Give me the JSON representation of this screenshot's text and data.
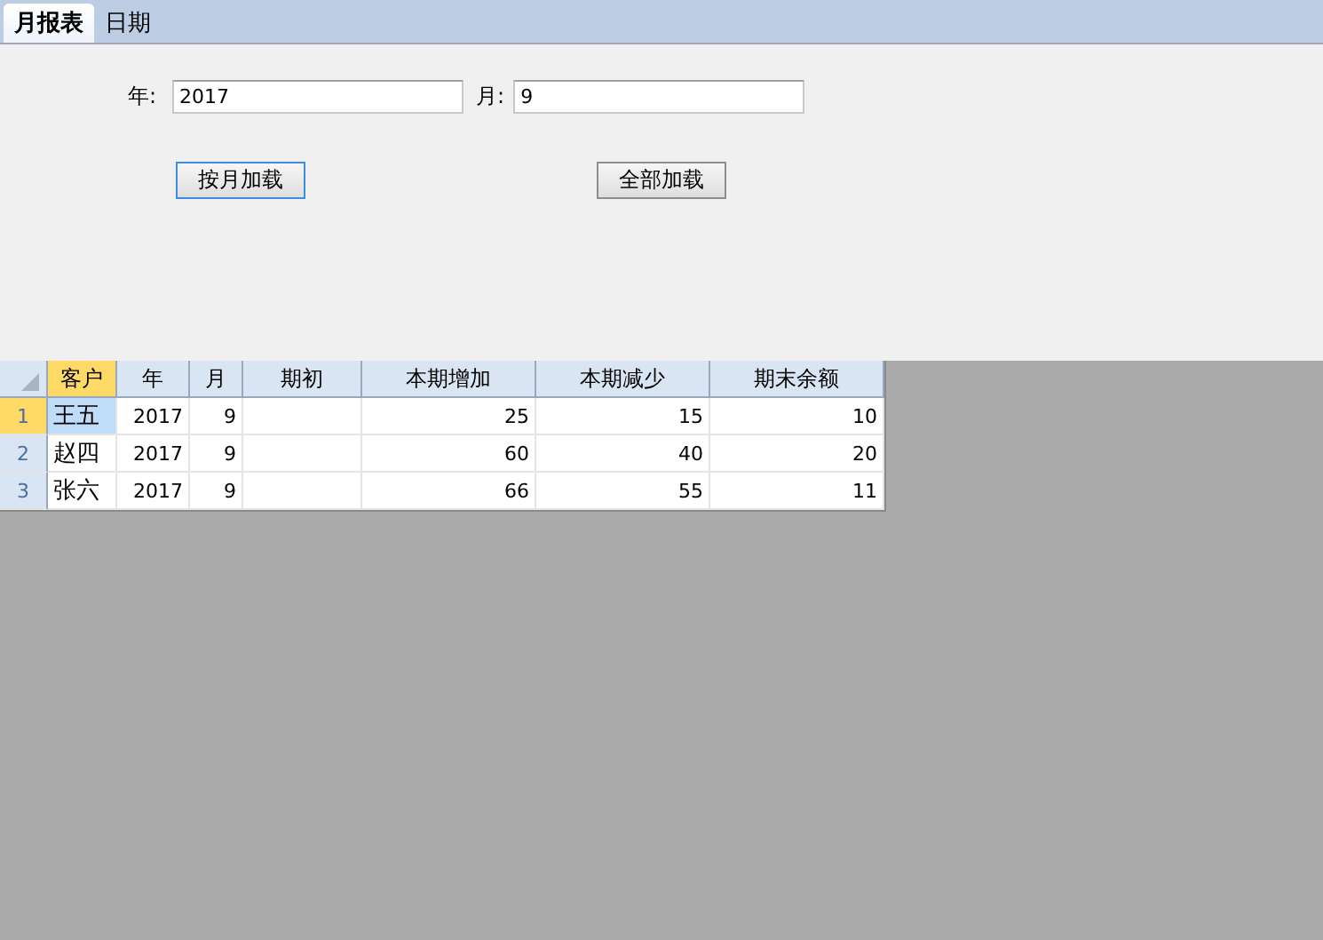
{
  "tabs": [
    {
      "label": "月报表",
      "selected": true
    },
    {
      "label": "日期",
      "selected": false
    }
  ],
  "form": {
    "year_label": "年:",
    "year_value": "2017",
    "month_label": "月:",
    "month_value": "9"
  },
  "buttons": [
    {
      "label": "按月加载",
      "focused": true
    },
    {
      "label": "全部加载",
      "focused": false
    }
  ],
  "table": {
    "columns": [
      {
        "label": "客户",
        "selected": true,
        "kind": "text"
      },
      {
        "label": "年",
        "selected": false,
        "kind": "number"
      },
      {
        "label": "月",
        "selected": false,
        "kind": "number"
      },
      {
        "label": "期初",
        "selected": false,
        "kind": "number"
      },
      {
        "label": "本期增加",
        "selected": false,
        "kind": "number"
      },
      {
        "label": "本期减少",
        "selected": false,
        "kind": "number"
      },
      {
        "label": "期末余额",
        "selected": false,
        "kind": "number"
      }
    ],
    "rows": [
      {
        "number": "1",
        "selected": true,
        "cells": [
          "王五",
          "2017",
          "9",
          "",
          "25",
          "15",
          "10"
        ]
      },
      {
        "number": "2",
        "selected": false,
        "cells": [
          "赵四",
          "2017",
          "9",
          "",
          "60",
          "40",
          "20"
        ]
      },
      {
        "number": "3",
        "selected": false,
        "cells": [
          "张六",
          "2017",
          "9",
          "",
          "66",
          "55",
          "11"
        ]
      }
    ]
  }
}
